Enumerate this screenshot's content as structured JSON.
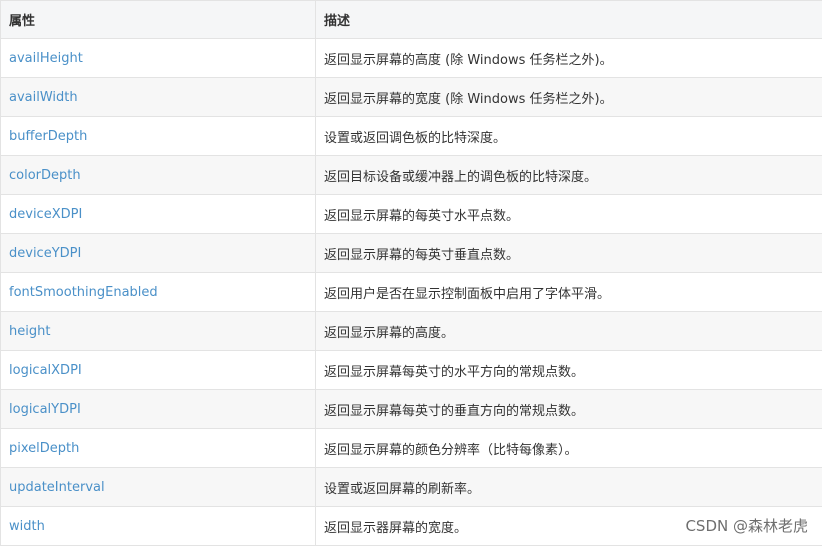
{
  "table": {
    "headers": {
      "property": "属性",
      "description": "描述"
    },
    "rows": [
      {
        "property": "availHeight",
        "description": "返回显示屏幕的高度 (除 Windows 任务栏之外)。"
      },
      {
        "property": "availWidth",
        "description": "返回显示屏幕的宽度 (除 Windows 任务栏之外)。"
      },
      {
        "property": "bufferDepth",
        "description": "设置或返回调色板的比特深度。"
      },
      {
        "property": "colorDepth",
        "description": "返回目标设备或缓冲器上的调色板的比特深度。"
      },
      {
        "property": "deviceXDPI",
        "description": "返回显示屏幕的每英寸水平点数。"
      },
      {
        "property": "deviceYDPI",
        "description": "返回显示屏幕的每英寸垂直点数。"
      },
      {
        "property": "fontSmoothingEnabled",
        "description": "返回用户是否在显示控制面板中启用了字体平滑。"
      },
      {
        "property": "height",
        "description": "返回显示屏幕的高度。"
      },
      {
        "property": "logicalXDPI",
        "description": "返回显示屏幕每英寸的水平方向的常规点数。"
      },
      {
        "property": "logicalYDPI",
        "description": "返回显示屏幕每英寸的垂直方向的常规点数。"
      },
      {
        "property": "pixelDepth",
        "description": "返回显示屏幕的颜色分辨率（比特每像素）。"
      },
      {
        "property": "updateInterval",
        "description": "设置或返回屏幕的刷新率。"
      },
      {
        "property": "width",
        "description": "返回显示器屏幕的宽度。"
      }
    ]
  },
  "watermark": "CSDN @森林老虎",
  "colors": {
    "link": "#4a90c8",
    "header_bg": "#f5f6f7",
    "row_alt_bg": "#f7f7f7",
    "border": "#e3e3e3"
  }
}
